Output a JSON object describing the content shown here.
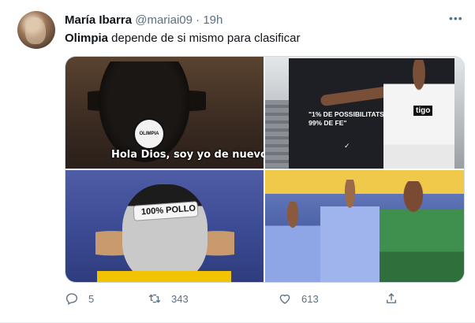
{
  "tweet": {
    "author": {
      "name": "María Ibarra",
      "handle": "@mariai09",
      "separator": "·",
      "time": "19h"
    },
    "text": {
      "bold": "Olimpia",
      "rest": " depende de si mismo para clasificar"
    },
    "media": [
      {
        "caption": "Hola Dios, soy yo de nuevo",
        "badge_text": "OLIMPIA"
      },
      {
        "caption_line1": "\"1% DE POSSIBILITATS,",
        "caption_line2": "99% DE FE\"",
        "sponsor": "tigo"
      },
      {
        "caption": "100% POLLO"
      },
      {
        "caption": ""
      }
    ],
    "actions": {
      "replies": "5",
      "retweets": "343",
      "likes": "613"
    },
    "icons": {
      "more": "more-dots-icon",
      "reply": "reply-icon",
      "retweet": "retweet-icon",
      "like": "heart-icon",
      "share": "share-icon"
    }
  }
}
